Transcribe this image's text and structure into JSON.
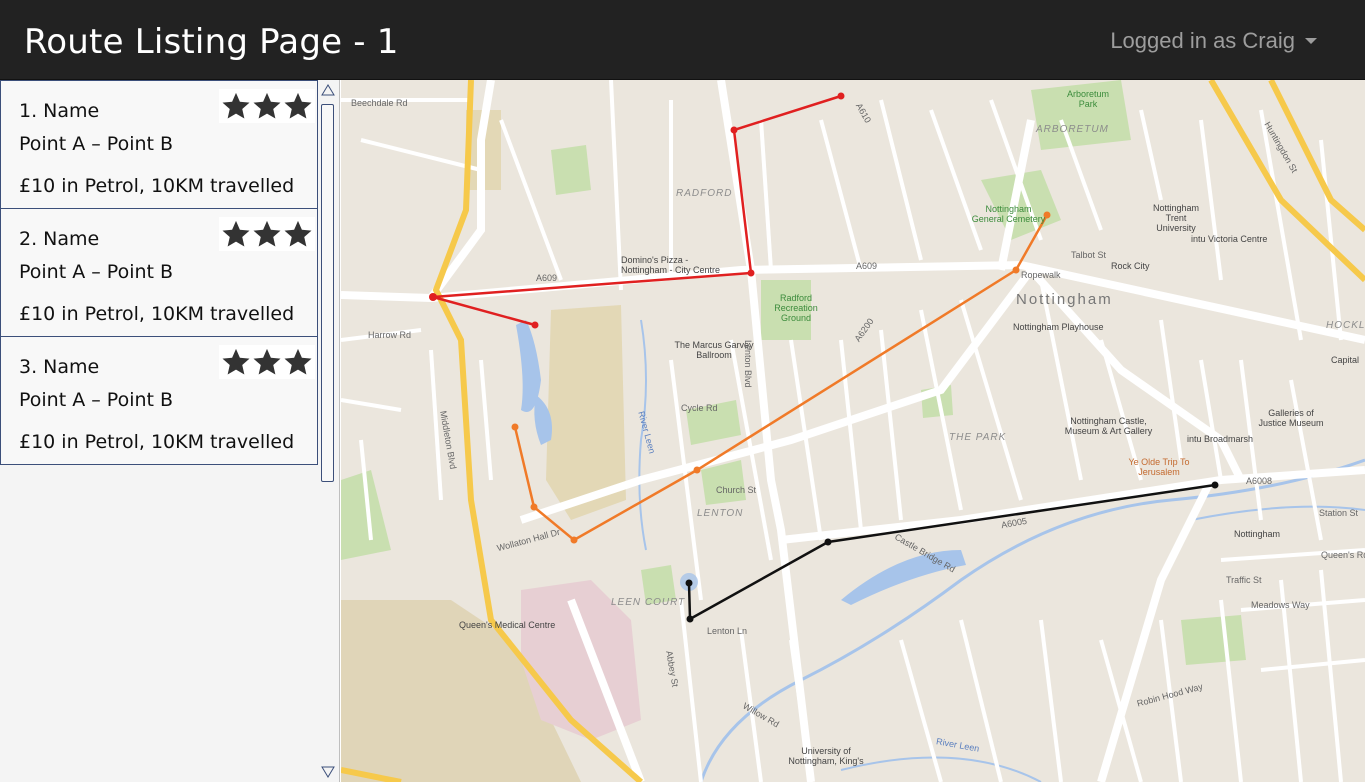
{
  "header": {
    "title": "Route Listing Page - 1",
    "user_menu": "Logged in as Craig"
  },
  "routes": [
    {
      "name": "1. Name",
      "points": "Point A – Point B",
      "cost": "£10 in Petrol, 10KM travelled",
      "rating": 3
    },
    {
      "name": "2. Name",
      "points": "Point A – Point B",
      "cost": "£10 in Petrol, 10KM travelled",
      "rating": 3
    },
    {
      "name": "3. Name",
      "points": "Point A – Point B",
      "cost": "£10 in Petrol, 10KM travelled",
      "rating": 3
    }
  ],
  "route_colors": {
    "route_1": "#e02020",
    "route_2": "#f07a28",
    "route_3": "#111111"
  },
  "icons": {
    "star": "star-icon",
    "scroll_up": "triangle-up-icon",
    "scroll_down": "triangle-down-icon",
    "caret": "caret-down-icon"
  },
  "map": {
    "labels": {
      "beechdale": "Beechdale Rd",
      "radford": "RADFORD",
      "dominos": "Domino's Pizza - Nottingham - City Centre",
      "radford_ground": "Radford Recreation Ground",
      "a609_west": "A609",
      "a609_east": "A609",
      "harrow": "Harrow Rd",
      "marcus": "The Marcus Garvey Ballroom",
      "nottingham": "Nottingham",
      "playhouse": "Nottingham Playhouse",
      "rock_city": "Rock City",
      "arboretum": "Arboretum Park",
      "arboretum_area": "ARBORETUM",
      "cemetery": "Nottingham General Cemetery",
      "trent": "Nottingham Trent University",
      "victoria": "intu Victoria Centre",
      "castle": "Nottingham Castle, Museum & Art Gallery",
      "the_park": "THE PARK",
      "ye_olde": "Ye Olde Trip To Jerusalem",
      "broadmarsh": "intu Broadmarsh",
      "galleries": "Galleries of Justice Museum",
      "station": "Nottingham",
      "lenton": "LENTON",
      "leen_court": "LEEN COURT",
      "qmc": "Queen's Medical Centre",
      "middleton": "Middleton Blvd",
      "a6200": "A6200",
      "a6005": "A6005",
      "a6008": "A6008",
      "a610": "A610",
      "huntingdon": "Huntingdon St",
      "lenton_blvd": "Lenton Blvd",
      "river_leen": "River Leen",
      "river_lenton": "River Leen",
      "university": "University of Nottingham, King's",
      "hockley": "HOCKLE",
      "capital": "Capital",
      "talbot": "Talbot St",
      "ropewalk": "Ropewalk",
      "wollaton": "Wollaton Hall Dr",
      "robin_hood": "Robin Hood Way",
      "queens_rd": "Queen's Rd",
      "meadows": "Meadows Way",
      "station_st": "Station St",
      "traffic_st": "Traffic St",
      "church_st": "Church St",
      "cycle_rd": "Cycle Rd",
      "castle_br": "Castle Bridge Rd",
      "lenton_ln": "Lenton Ln",
      "willow": "Willow Rd",
      "abbey": "Abbey St"
    }
  }
}
